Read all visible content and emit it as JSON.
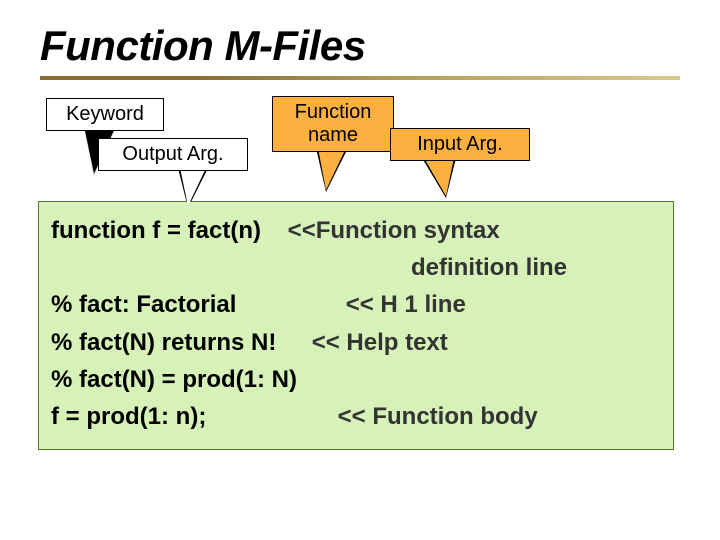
{
  "title": "Function M-Files",
  "callouts": {
    "keyword": "Keyword",
    "output_arg": "Output Arg.",
    "function_name_l1": "Function",
    "function_name_l2": "name",
    "input_arg": "Input Arg."
  },
  "code": {
    "line1_left": "function f = fact(n)",
    "line1_right": "<<Function syntax",
    "line2_right": "definition line",
    "line3_left": "% fact: Factorial",
    "line3_right": "<< H 1 line",
    "line4_left": "% fact(N) returns N!",
    "line4_right": "<< Help text",
    "line5_left": "% fact(N) = prod(1: N)",
    "line6_left": "f = prod(1: n);",
    "line6_right": "<< Function body"
  }
}
